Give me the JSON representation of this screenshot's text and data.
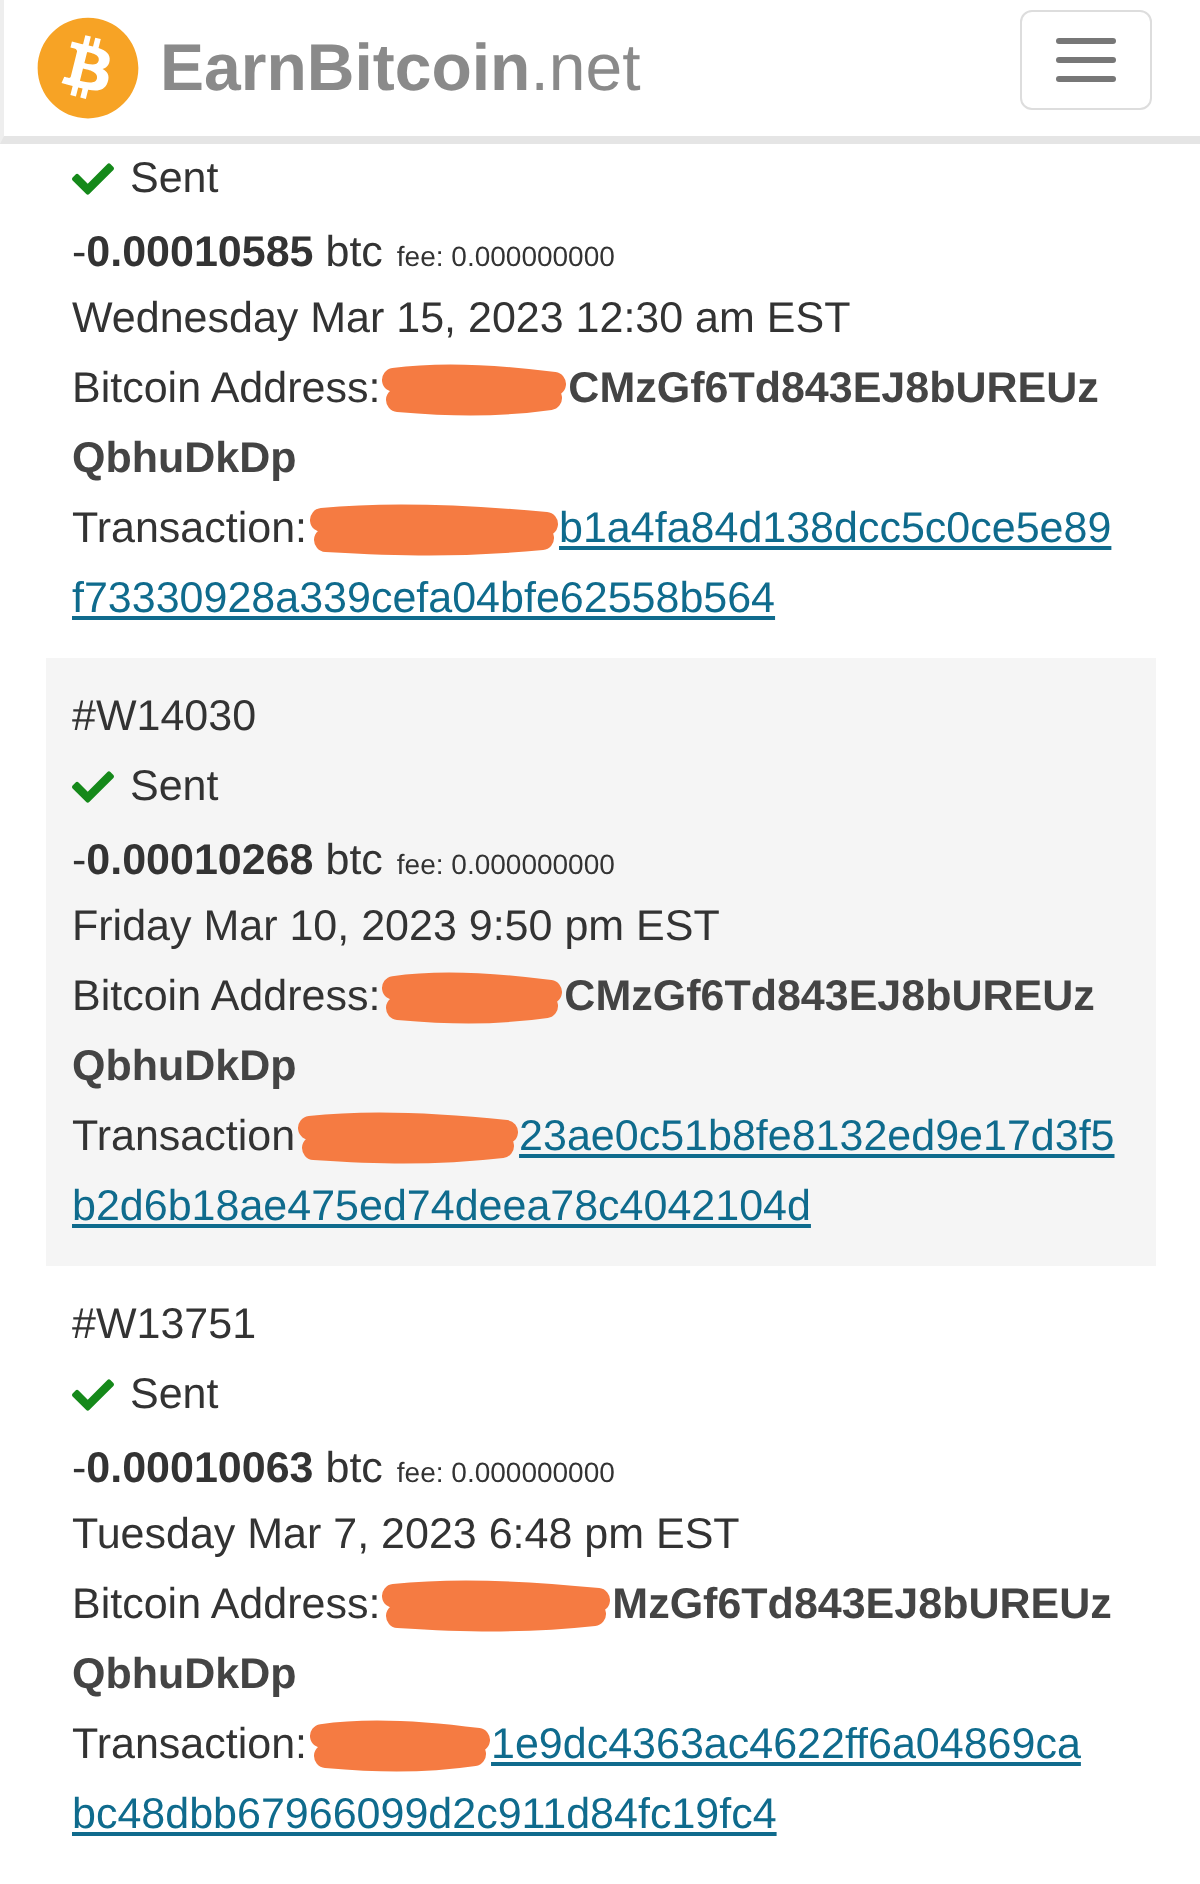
{
  "header": {
    "site_name": "**EarnBitcoin**.net"
  },
  "withdrawals": [
    {
      "status": {
        "kind": "sent",
        "label": "Sent"
      },
      "amount": "-**0.00010585** btc",
      "fee": "fee: 0.000000000",
      "date": "Wednesday Mar 15, 2023 12:30 am EST",
      "address_label": "Bitcoin Address:",
      "address_lines": [
        "CMzGf6Td843EJ8bUREUz",
        "QbhuDkDp"
      ],
      "transaction_label": "Transaction:",
      "transaction_lines": [
        "b1a4fa84d138dcc5c0ce5e89",
        "f73330928a339cefa04bfe62558b564"
      ]
    },
    {
      "id": "#W14030",
      "status": {
        "kind": "sent",
        "label": "Sent"
      },
      "amount": "-**0.00010268** btc",
      "fee": "fee: 0.000000000",
      "date": "Friday Mar 10, 2023 9:50 pm EST",
      "address_label": "Bitcoin Address:",
      "address_lines": [
        "CMzGf6Td843EJ8bUREUz",
        "QbhuDkDp"
      ],
      "transaction_label": "Transaction",
      "transaction_lines": [
        "23ae0c51b8fe8132ed9e17d3f5",
        "b2d6b18ae475ed74deea78c4042104d"
      ]
    },
    {
      "id": "#W13751",
      "status": {
        "kind": "sent",
        "label": "Sent"
      },
      "amount": "-**0.00010063** btc",
      "fee": "fee: 0.000000000",
      "date": "Tuesday Mar 7, 2023 6:48 pm EST",
      "address_label": "Bitcoin Address:",
      "address_lines": [
        "MzGf6Td843EJ8bUREUz",
        "QbhuDkDp"
      ],
      "transaction_label": "Transaction:",
      "transaction_lines": [
        "1e9dc4363ac4622ff6a04869ca",
        "bc48dbb67966099d2c911d84fc19fc4"
      ]
    }
  ]
}
